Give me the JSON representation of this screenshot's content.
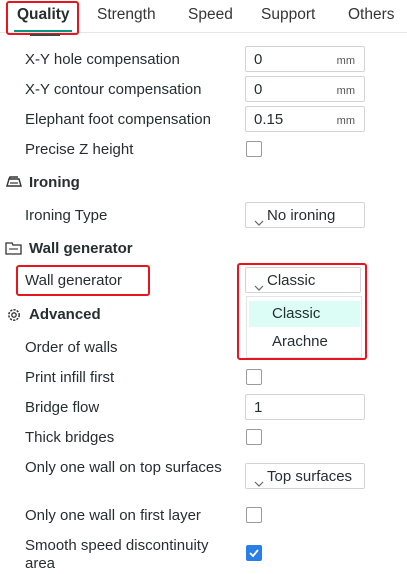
{
  "tabs": [
    {
      "label": "Quality"
    },
    {
      "label": "Strength"
    },
    {
      "label": "Speed"
    },
    {
      "label": "Support"
    },
    {
      "label": "Others"
    }
  ],
  "rows": {
    "xy_hole": {
      "label": "X-Y hole compensation",
      "value": "0",
      "unit": "mm"
    },
    "xy_contour": {
      "label": "X-Y contour compensation",
      "value": "0",
      "unit": "mm"
    },
    "elephant_foot": {
      "label": "Elephant foot compensation",
      "value": "0.15",
      "unit": "mm"
    },
    "precise_z": {
      "label": "Precise Z height",
      "checked": false
    }
  },
  "sections": {
    "ironing": {
      "title": "Ironing",
      "icon": "ironing-icon"
    },
    "wall_generator": {
      "title": "Wall generator",
      "icon": "wall-generator-icon"
    },
    "advanced": {
      "title": "Advanced",
      "icon": "gear-icon"
    }
  },
  "ironing": {
    "type_label": "Ironing Type",
    "type_value": "No ironing"
  },
  "wall_generator": {
    "label": "Wall generator",
    "value": "Classic",
    "options": [
      "Classic",
      "Arachne"
    ],
    "selected_option": "Classic"
  },
  "advanced": {
    "order_of_walls": "Order of walls",
    "print_infill_first": {
      "label": "Print infill first",
      "checked": false
    },
    "bridge_flow": {
      "label": "Bridge flow",
      "value": "1"
    },
    "thick_bridges": {
      "label": "Thick bridges",
      "checked": false
    },
    "one_wall_top": {
      "label": "Only one wall on top surfaces",
      "value": "Top surfaces"
    },
    "one_wall_first": {
      "label": "Only one wall on first layer",
      "checked": false
    },
    "smooth_speed": {
      "label": "Smooth speed discontinuity area",
      "checked": true
    }
  },
  "colors": {
    "accent": "#009688",
    "highlight": "#e8151f",
    "checkbox_checked": "#2a7fe6",
    "dropdown_selected": "#dbfdf5"
  }
}
